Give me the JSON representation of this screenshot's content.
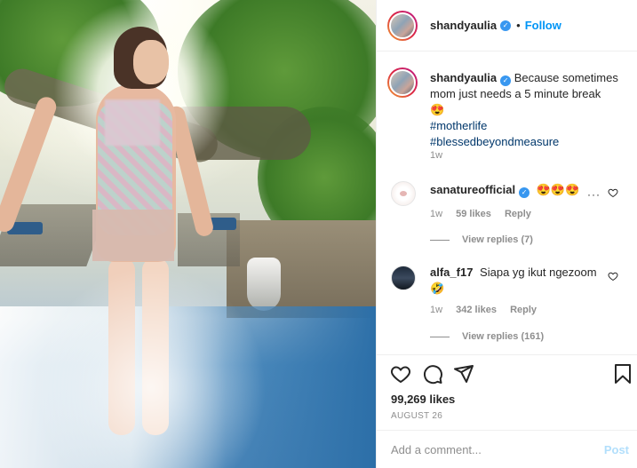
{
  "header": {
    "username": "shandyaulia",
    "verified_icon": "verified-badge-icon",
    "separator": "•",
    "follow_label": "Follow"
  },
  "caption": {
    "username": "shandyaulia",
    "text": "Because sometimes mom just needs a 5 minute break",
    "emoji": "😍",
    "hashtags": [
      "#motherlife",
      "#blessedbeyondmeasure"
    ],
    "time": "1w"
  },
  "comments": [
    {
      "username": "sanatureofficial",
      "verified": true,
      "text": "😍😍😍",
      "time": "1w",
      "likes": "59 likes",
      "reply_label": "Reply",
      "view_replies": "View replies (7)",
      "more": "···"
    },
    {
      "username": "alfa_f17",
      "verified": false,
      "text": "Siapa yg ikut ngezoom",
      "emoji": "🤣",
      "time": "1w",
      "likes": "342 likes",
      "reply_label": "Reply",
      "view_replies": "View replies (161)"
    }
  ],
  "actions": {
    "icons": [
      "heart-icon",
      "comment-icon",
      "share-icon",
      "bookmark-icon"
    ],
    "likes": "99,269 likes",
    "date": "AUGUST 26"
  },
  "add_comment": {
    "placeholder": "Add a comment...",
    "post_label": "Post"
  },
  "colors": {
    "accent": "#0095f6",
    "tag": "#00376b",
    "muted": "#8e8e8e",
    "post_disabled": "#b2dffc"
  }
}
